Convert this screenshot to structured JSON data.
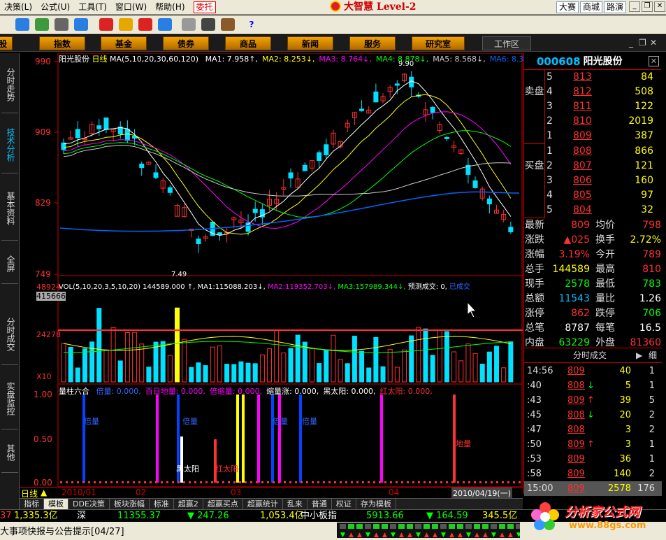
{
  "menubar": {
    "items": [
      "决策(L)",
      "公式(U)",
      "工具(T)",
      "窗口(W)",
      "帮助(H)"
    ],
    "entrust": "委托",
    "brand": "大智慧 Level-2",
    "links": [
      "大赛",
      "商城",
      "路演"
    ]
  },
  "navbar": {
    "tabs": [
      "股",
      "指数",
      "基金",
      "债券",
      "商品",
      "新闻",
      "服务",
      "研究室"
    ],
    "work": "工作区"
  },
  "sidebar": {
    "tabs": [
      "分时走势",
      "技术分析",
      "基本资料",
      "全屏",
      "分时成交",
      "实盘监控",
      "其他"
    ]
  },
  "kline": {
    "header_name": "阳光股份",
    "header_period": "日线",
    "ma_label": "MA(5,10,20,30,60,120)",
    "ma_values": [
      {
        "label": "MA1:",
        "value": "7.958",
        "dir": "↑",
        "color": "#ffffff"
      },
      {
        "label": "MA2:",
        "value": "8.253",
        "dir": "↓",
        "color": "#ffff00"
      },
      {
        "label": "MA3:",
        "value": "8.764",
        "dir": "↓",
        "color": "#ff00ff"
      },
      {
        "label": "MA4:",
        "value": "8.878",
        "dir": "↓",
        "color": "#00ff00"
      },
      {
        "label": "MA5:",
        "value": "8.568",
        "dir": "↓",
        "color": "#cccccc"
      },
      {
        "label": "MA6:",
        "value": "8.336",
        "dir": "↓",
        "color": "#0066ff"
      }
    ],
    "y_ticks": [
      "990",
      "909",
      "829",
      "749"
    ],
    "hi_label": "9.90",
    "lo_label": "7.49"
  },
  "volume": {
    "header": "VOL(5,10,20,3,5,10,20)",
    "value": "144589.000",
    "ma1": "115088.203",
    "ma2": "119352.703",
    "ma3": "157989.344",
    "forecast_label": "预测成交: 0,",
    "done_label": "已成交",
    "y_ticks": [
      "48924",
      "415666",
      "24278",
      "X10"
    ]
  },
  "indicator": {
    "header": "量柱六合",
    "items": [
      {
        "label": "倍量:",
        "value": "0.000",
        "color": "#3366ff"
      },
      {
        "label": "百日地量:",
        "value": "0.000",
        "color": "#ff00ff"
      },
      {
        "label": "倍缩量:",
        "value": "0.000",
        "color": "#ff00ff"
      },
      {
        "label": "缩量涨:",
        "value": "0.000",
        "color": "#ffffff"
      },
      {
        "label": "黑太阳:",
        "value": "0.000",
        "color": "#ffffff"
      },
      {
        "label": "红太阳:",
        "value": "0.000",
        "color": "#ff3030"
      }
    ],
    "y_ticks": [
      "1.00",
      "0.50",
      "0.00"
    ],
    "labels": [
      "倍量",
      "倍量",
      "倍量",
      "倍量",
      "地量",
      "黑太阳",
      "红太阳"
    ]
  },
  "xaxis": {
    "period": "日线",
    "labels": [
      "2010/01",
      "02",
      "03",
      "04"
    ],
    "date_box": "2010/04/19(一)"
  },
  "quote": {
    "code": "000608",
    "name": "阳光股份",
    "sell_label": "卖盘",
    "buy_label": "买盘",
    "asks": [
      {
        "level": "5",
        "price": "813",
        "vol": "84"
      },
      {
        "level": "4",
        "price": "812",
        "vol": "508"
      },
      {
        "level": "3",
        "price": "811",
        "vol": "122"
      },
      {
        "level": "2",
        "price": "810",
        "vol": "2019"
      },
      {
        "level": "1",
        "price": "809",
        "vol": "387"
      }
    ],
    "bids": [
      {
        "level": "1",
        "price": "808",
        "vol": "866"
      },
      {
        "level": "2",
        "price": "807",
        "vol": "121"
      },
      {
        "level": "3",
        "price": "806",
        "vol": "160"
      },
      {
        "level": "4",
        "price": "805",
        "vol": "97"
      },
      {
        "level": "5",
        "price": "804",
        "vol": "32"
      }
    ],
    "stats": [
      {
        "k1": "最新",
        "v1": "809",
        "c1": "#ff3030",
        "k2": "均价",
        "v2": "798",
        "c2": "#ff3030"
      },
      {
        "k1": "涨跌",
        "v1": "▲025",
        "c1": "#ff3030",
        "k2": "换手",
        "v2": "2.72%",
        "c2": "#ffff00"
      },
      {
        "k1": "涨幅",
        "v1": "3.19%",
        "c1": "#ff3030",
        "k2": "今开",
        "v2": "789",
        "c2": "#ff3030"
      },
      {
        "k1": "总手",
        "v1": "144589",
        "c1": "#ffff00",
        "k2": "最高",
        "v2": "810",
        "c2": "#ff3030"
      },
      {
        "k1": "现手",
        "v1": "2578",
        "c1": "#00ff00",
        "k2": "最低",
        "v2": "783",
        "c2": "#00ff00"
      },
      {
        "k1": "总额",
        "v1": "11543",
        "c1": "#00c0ff",
        "k2": "量比",
        "v2": "1.26",
        "c2": "#ffffff"
      },
      {
        "k1": "涨停",
        "v1": "862",
        "c1": "#ff3030",
        "k2": "跌停",
        "v2": "706",
        "c2": "#00ff00"
      },
      {
        "k1": "总笔",
        "v1": "8787",
        "c1": "#ffffff",
        "k2": "每笔",
        "v2": "16.5",
        "c2": "#ffffff"
      },
      {
        "k1": "内盘",
        "v1": "63229",
        "c1": "#00ff00",
        "k2": "外盘",
        "v2": "81360",
        "c2": "#ff3030"
      }
    ],
    "ticks_title": "分时成交",
    "ticks_detail": "细",
    "ticks": [
      {
        "time": "14:56",
        "price": "809",
        "vol": "40",
        "n": "1",
        "arrow": ""
      },
      {
        "time": ":40",
        "price": "808",
        "vol": "5",
        "n": "1",
        "arrow": "down"
      },
      {
        "time": ":43",
        "price": "809",
        "vol": "39",
        "n": "5",
        "arrow": "up"
      },
      {
        "time": ":45",
        "price": "808",
        "vol": "20",
        "n": "2",
        "arrow": "down"
      },
      {
        "time": ":47",
        "price": "808",
        "vol": "3",
        "n": "2",
        "arrow": ""
      },
      {
        "time": ":50",
        "price": "809",
        "vol": "3",
        "n": "1",
        "arrow": "up"
      },
      {
        "time": ":53",
        "price": "809",
        "vol": "36",
        "n": "1",
        "arrow": ""
      },
      {
        "time": ":58",
        "price": "809",
        "vol": "140",
        "n": "2",
        "arrow": ""
      },
      {
        "time": "15:00",
        "price": "809",
        "vol": "2578",
        "n": "176",
        "arrow": ""
      }
    ]
  },
  "bottom_tabs": [
    "指标",
    "模板",
    "DDE决策",
    "板块涨幅",
    "标准",
    "超赢2",
    "超赢买点",
    "超赢统计",
    "乱来",
    "普通",
    "权证",
    "存为模板"
  ],
  "ticker": [
    {
      "text": "37",
      "color": "#ff3030"
    },
    {
      "text": "1,335.3亿",
      "color": "#ffff00"
    },
    {
      "text": "深",
      "color": "#ffffff"
    },
    {
      "text": "11355.37",
      "color": "#00ff00"
    },
    {
      "text": "▼ 247.26",
      "color": "#00ff00"
    },
    {
      "text": "1,053.4亿",
      "color": "#ffff00"
    },
    {
      "text": "中小板指",
      "color": "#ffffff"
    },
    {
      "text": "5913.66",
      "color": "#00ff00"
    },
    {
      "text": "▼ 164.59",
      "color": "#00ff00"
    },
    {
      "text": "345.5亿",
      "color": "#ffff00"
    }
  ],
  "status": {
    "text": "大事项快报与公告提示[04/27]"
  },
  "logo": {
    "title": "分析家公式网",
    "url": "www.88gs.com"
  },
  "colors": {
    "up": "#ff3030",
    "down": "#00e0ff",
    "accent": "#00c0ff",
    "grid": "#800000"
  }
}
